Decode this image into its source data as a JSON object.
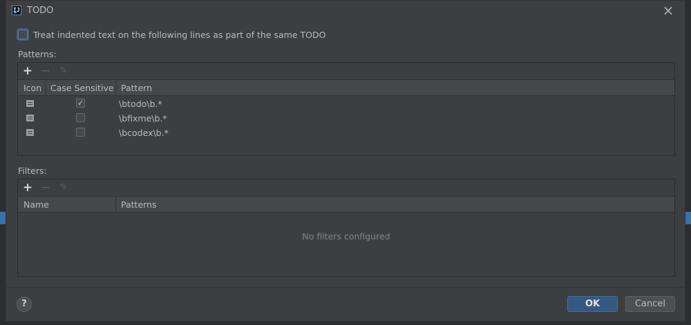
{
  "window": {
    "title": "TODO",
    "app_icon_text": "IJ"
  },
  "option": {
    "label": "Treat indented text on the following lines as part of the same TODO",
    "checked": false
  },
  "patterns": {
    "section_label": "Patterns:",
    "toolbar": {
      "add": "+",
      "remove": "−",
      "edit": "✎"
    },
    "columns": [
      "Icon",
      "Case Sensitive",
      "Pattern"
    ],
    "rows": [
      {
        "icon": "todo-icon",
        "case_sensitive": true,
        "check_mark": "✓",
        "pattern": "\\btodo\\b.*"
      },
      {
        "icon": "todo-icon",
        "case_sensitive": false,
        "check_mark": "",
        "pattern": "\\bfixme\\b.*"
      },
      {
        "icon": "todo-icon",
        "case_sensitive": false,
        "check_mark": "",
        "pattern": "\\bcodex\\b.*"
      }
    ]
  },
  "filters": {
    "section_label": "Filters:",
    "toolbar": {
      "add": "+",
      "remove": "−",
      "edit": "✎"
    },
    "columns": [
      "Name",
      "Patterns"
    ],
    "empty_text": "No filters configured"
  },
  "buttons": {
    "help": "?",
    "ok": "OK",
    "cancel": "Cancel"
  },
  "colors": {
    "dialog_bg": "#3c3f41",
    "header_bg": "#45484a",
    "ok_bg": "#365880",
    "accent": "#3574a8"
  }
}
